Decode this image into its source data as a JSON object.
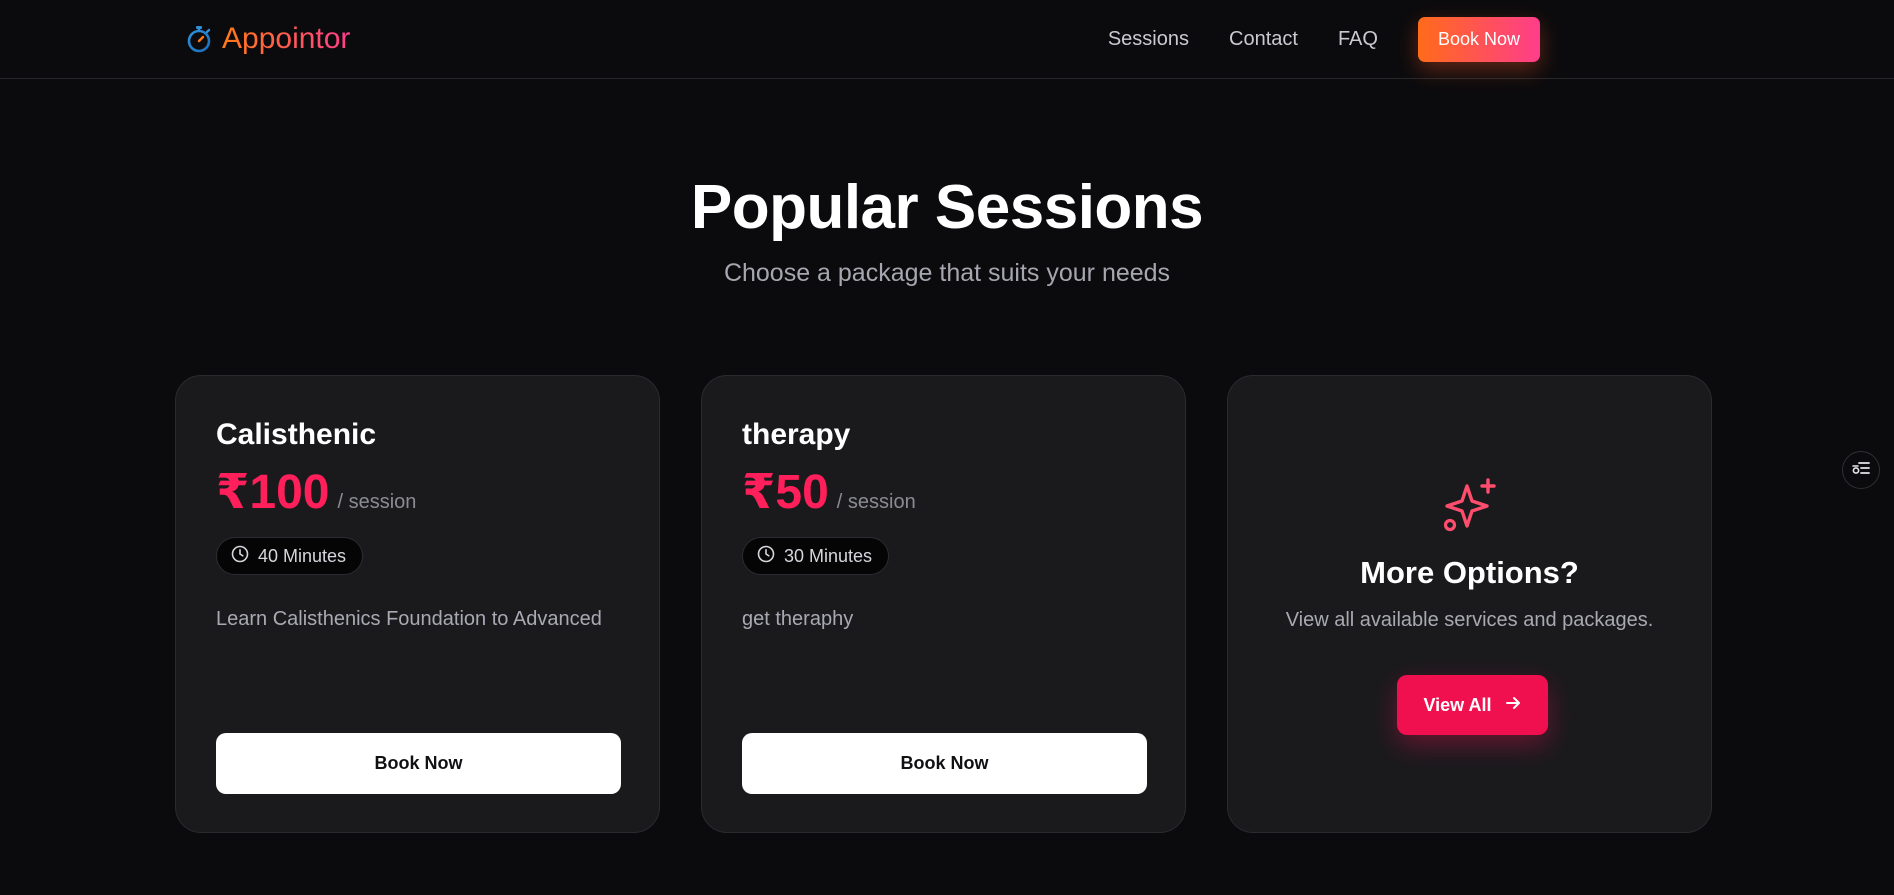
{
  "nav": {
    "brand": "Appointor",
    "links": [
      "Sessions",
      "Contact",
      "FAQ"
    ],
    "cta": "Book Now"
  },
  "hero": {
    "title": "Popular Sessions",
    "subtitle": "Choose a package that suits your needs"
  },
  "sessions": [
    {
      "title": "Calisthenic",
      "price": "₹100",
      "per": "/ session",
      "duration": "40 Minutes",
      "description": "Learn Calisthenics Foundation to Advanced",
      "button": "Book Now"
    },
    {
      "title": "therapy",
      "price": "₹50",
      "per": "/ session",
      "duration": "30 Minutes",
      "description": "get theraphy",
      "button": "Book Now"
    }
  ],
  "more": {
    "title": "More Options?",
    "subtitle": "View all available services and packages.",
    "button": "View All"
  },
  "colors": {
    "accent": "#f0104f",
    "price": "#ff1f5a",
    "brand_gradient_start": "#ff7a18",
    "brand_gradient_end": "#ff3d8b",
    "background": "#0b0b0d",
    "card": "#1a1a1d"
  },
  "icons": {
    "brand": "stopwatch-icon",
    "duration": "clock-icon",
    "more": "sparkles-icon",
    "view_all": "arrow-right-icon",
    "side": "list-settings-icon"
  }
}
